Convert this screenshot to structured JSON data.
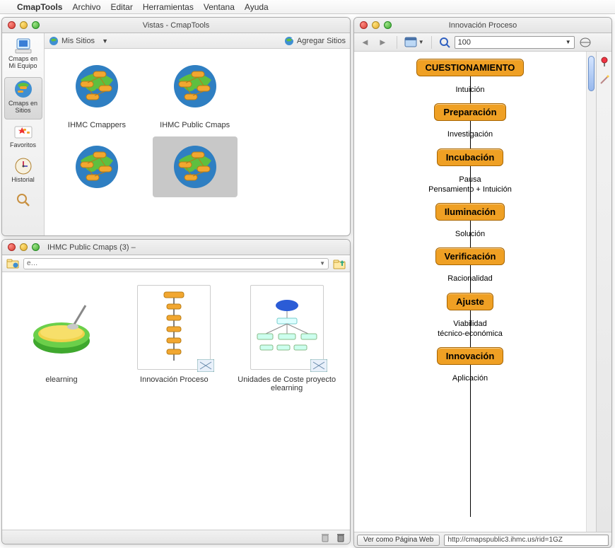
{
  "menubar": {
    "appname": "CmapTools",
    "items": [
      "Archivo",
      "Editar",
      "Herramientas",
      "Ventana",
      "Ayuda"
    ]
  },
  "windows": {
    "vistas": {
      "title": "Vistas - CmapTools",
      "toolbar": {
        "mysites": "Mis Sitios",
        "addsites": "Agregar Sitios"
      },
      "sidebar": {
        "items": [
          {
            "label": "Cmaps en Mi Equipo"
          },
          {
            "label": "Cmaps en Sitios"
          },
          {
            "label": "Favoritos"
          },
          {
            "label": "Historial"
          }
        ]
      },
      "sites": [
        {
          "label": "IHMC Cmappers"
        },
        {
          "label": "IHMC Public Cmaps"
        },
        {
          "label": ""
        },
        {
          "label": ""
        }
      ]
    },
    "public": {
      "title": "IHMC Public Cmaps (3) – ",
      "address": "e…",
      "files": [
        {
          "label": "elearning"
        },
        {
          "label": "Innovación Proceso"
        },
        {
          "label": "Unidades de Coste proyecto elearning"
        }
      ]
    },
    "innov": {
      "title": "Innovación Proceso",
      "zoom": "100",
      "flow": {
        "nodes": [
          "CUESTIONAMIENTO",
          "Preparación",
          "Incubación",
          "Iluminación",
          "Verificación",
          "Ajuste",
          "Innovación"
        ],
        "links": [
          "Intuición",
          "Investigación",
          "Pausa\nPensamiento + Intuición",
          "Solución",
          "Racionalidad",
          "Viabilidad\ntécnico-económica",
          "Aplicación"
        ]
      },
      "footer": {
        "webbtn": "Ver como Página Web",
        "url": "http://cmapspublic3.ihmc.us/rid=1GZ"
      }
    }
  }
}
